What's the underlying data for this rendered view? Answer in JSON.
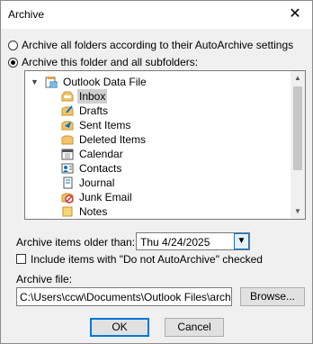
{
  "window": {
    "title": "Archive",
    "close_glyph": "✕"
  },
  "options": {
    "archive_all_label": "Archive all folders according to their AutoArchive settings",
    "archive_this_label": "Archive this folder and all subfolders:",
    "selected": "archive_this"
  },
  "tree": {
    "root": "Outlook Data File",
    "items": [
      {
        "label": "Inbox",
        "icon": "inbox-icon",
        "selected": true
      },
      {
        "label": "Drafts",
        "icon": "drafts-icon"
      },
      {
        "label": "Sent Items",
        "icon": "sent-items-icon"
      },
      {
        "label": "Deleted Items",
        "icon": "deleted-items-icon"
      },
      {
        "label": "Calendar",
        "icon": "calendar-icon"
      },
      {
        "label": "Contacts",
        "icon": "contacts-icon"
      },
      {
        "label": "Journal",
        "icon": "journal-icon"
      },
      {
        "label": "Junk Email",
        "icon": "junk-email-icon"
      },
      {
        "label": "Notes",
        "icon": "notes-icon"
      }
    ]
  },
  "older_than": {
    "label": "Archive items older than:",
    "value": "Thu 4/24/2025"
  },
  "include_checkbox": {
    "label": "Include items with \"Do not AutoArchive\" checked",
    "checked": false
  },
  "archive_file": {
    "label": "Archive file:",
    "value": "C:\\Users\\ccw\\Documents\\Outlook Files\\archive.pst"
  },
  "buttons": {
    "browse": "Browse...",
    "ok": "OK",
    "cancel": "Cancel"
  },
  "colors": {
    "accent": "#0078d7",
    "selection": "#cfcfcf"
  }
}
